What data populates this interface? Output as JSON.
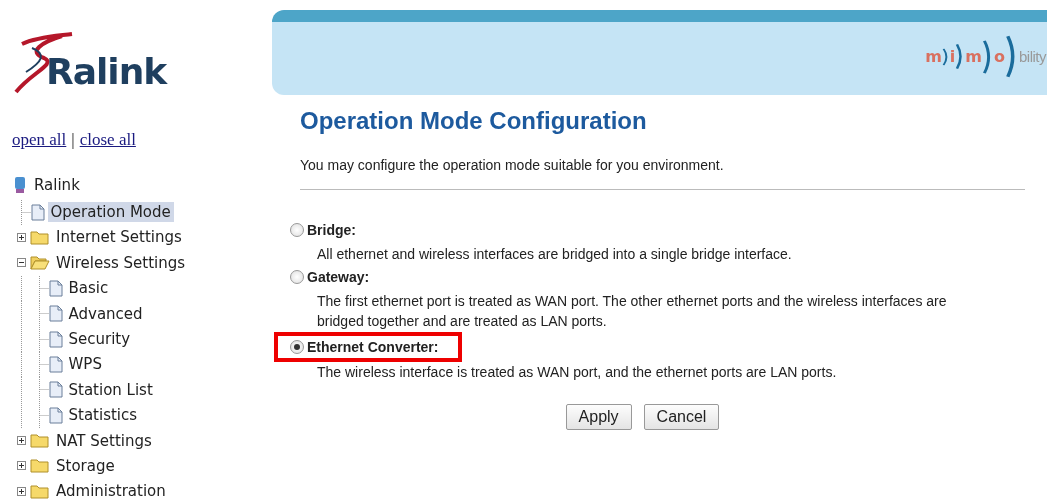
{
  "logo": {
    "text": "Ralink"
  },
  "brand": {
    "letters": [
      "m",
      "i",
      "m",
      "o"
    ],
    "suffix": "bility"
  },
  "tree_links": [
    "open all",
    "close all"
  ],
  "tree_links_separator": "|",
  "tree": {
    "label": "Ralink",
    "children": [
      {
        "label": "Operation Mode",
        "kind": "page",
        "selected": true
      },
      {
        "label": "Internet Settings",
        "kind": "folder",
        "expanded": false,
        "selected": false
      },
      {
        "label": "Wireless Settings",
        "kind": "folder",
        "expanded": true,
        "selected": false,
        "children": [
          {
            "label": "Basic",
            "kind": "page",
            "selected": false
          },
          {
            "label": "Advanced",
            "kind": "page",
            "selected": false
          },
          {
            "label": "Security",
            "kind": "page",
            "selected": false
          },
          {
            "label": "WPS",
            "kind": "page",
            "selected": false
          },
          {
            "label": "Station List",
            "kind": "page",
            "selected": false
          },
          {
            "label": "Statistics",
            "kind": "page",
            "selected": false
          }
        ]
      },
      {
        "label": "NAT Settings",
        "kind": "folder",
        "expanded": false,
        "selected": false
      },
      {
        "label": "Storage",
        "kind": "folder",
        "expanded": false,
        "selected": false
      },
      {
        "label": "Administration",
        "kind": "folder",
        "expanded": false,
        "selected": false
      }
    ]
  },
  "title": "Operation Mode Configuration",
  "description": "You may configure the operation mode suitable for you environment.",
  "modes": [
    {
      "label": "Bridge:",
      "description": "All ethernet and wireless interfaces are bridged into a single bridge interface.",
      "selected": false,
      "highlighted": false
    },
    {
      "label": "Gateway:",
      "description": "The first ethernet port is treated as WAN port. The other ethernet ports and the wireless interfaces are bridged together and are treated as LAN ports.",
      "selected": false,
      "highlighted": false
    },
    {
      "label": "Ethernet Converter:",
      "description": "The wireless interface is treated as WAN port, and the ethernet ports are LAN ports.",
      "selected": true,
      "highlighted": true
    }
  ],
  "buttons": [
    "Apply",
    "Cancel"
  ]
}
